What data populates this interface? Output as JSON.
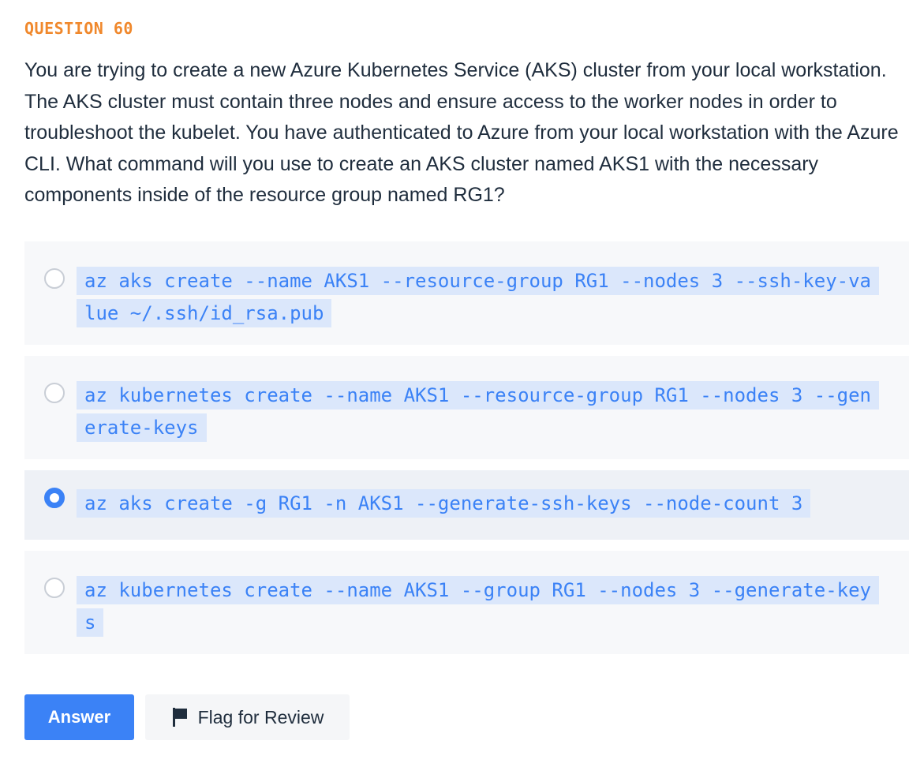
{
  "question": {
    "label": "QUESTION 60",
    "text": "You are trying to create a new Azure Kubernetes Service (AKS) cluster from your local workstation. The AKS cluster must contain three nodes and ensure access to the worker nodes in order to troubleshoot the kubelet. You have authenticated to Azure from your local workstation with the Azure CLI. What command will you use to create an AKS cluster named AKS1 with the necessary components inside of the resource group named RG1?"
  },
  "options": [
    {
      "text": "az aks create --name AKS1 --resource-group RG1 --nodes 3 --ssh-key-value ~/.ssh/id_rsa.pub",
      "selected": false
    },
    {
      "text": "az kubernetes create --name AKS1 --resource-group RG1 --nodes 3 --generate-keys",
      "selected": false
    },
    {
      "text": "az aks create -g RG1 -n AKS1 --generate-ssh-keys --node-count 3",
      "selected": true
    },
    {
      "text": "az kubernetes create --name AKS1 --group RG1 --nodes 3 --generate-keys",
      "selected": false
    }
  ],
  "actions": {
    "answer_label": "Answer",
    "flag_label": "Flag for Review"
  },
  "colors": {
    "accent": "#3b82f6",
    "question_label": "#f0882c",
    "code_highlight": "#dbe7fb"
  },
  "icons": {
    "flag": "flag-icon"
  }
}
